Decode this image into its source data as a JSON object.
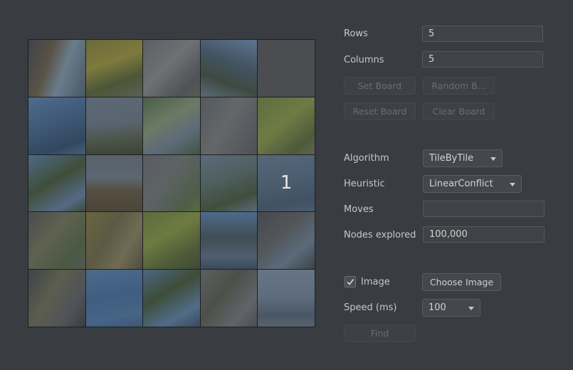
{
  "board": {
    "tiles": [
      {
        "label": "",
        "empty": false,
        "bg": "linear-gradient(110deg,#3d434a 0%,#5a5246 35%,#6a7c8c 60%,#4a5663 100%)"
      },
      {
        "label": "",
        "empty": false,
        "bg": "linear-gradient(160deg,#6b6a3a 0%,#7d7a3e 40%,#4d5638 70%,#5b5f54 100%)"
      },
      {
        "label": "",
        "empty": false,
        "bg": "linear-gradient(135deg,#5c5f62 0%,#6f7073 45%,#4e5356 80%,#5a5a52 100%)"
      },
      {
        "label": "",
        "empty": false,
        "bg": "linear-gradient(200deg,#5d7591 0%,#435462 40%,#3e4a40 70%,#5a6a78 100%)"
      },
      {
        "label": "",
        "empty": true,
        "bg": ""
      },
      {
        "label": "",
        "empty": false,
        "bg": "linear-gradient(160deg,#4e6c8e 0%,#3f5876 45%,#33485f 80%,#465e79 100%)"
      },
      {
        "label": "",
        "empty": false,
        "bg": "linear-gradient(175deg,#5b6877 0%,#5a6470 45%,#4a5346 75%,#3c4238 100%)"
      },
      {
        "label": "",
        "empty": false,
        "bg": "linear-gradient(150deg,#4a5f46 0%,#6b7a66 40%,#5c6a78 70%,#425340 100%)"
      },
      {
        "label": "",
        "empty": false,
        "bg": "linear-gradient(120deg,#55585c 0%,#64676a 45%,#4d5055 100%)"
      },
      {
        "label": "",
        "empty": false,
        "bg": "linear-gradient(140deg,#5c6e3e 0%,#6f7b45 45%,#4e5a3a 80%,#5d6550 100%)"
      },
      {
        "label": "",
        "empty": false,
        "bg": "linear-gradient(150deg,#4e6a85 0%,#3f4e3a 45%,#546a84 80%,#3c4a3a 100%)"
      },
      {
        "label": "",
        "empty": false,
        "bg": "linear-gradient(180deg,#58626b 0%,#5c6670 40%,#554d40 65%,#4b463b 100%)"
      },
      {
        "label": "",
        "empty": false,
        "bg": "linear-gradient(130deg,#595c60 0%,#5e6366 40%,#4f5d4a 80%,#5a6a3e 100%)"
      },
      {
        "label": "",
        "empty": false,
        "bg": "linear-gradient(160deg,#5b6a7a 0%,#4f6060 40%,#3f4e3c 75%,#5a6a7a 100%)"
      },
      {
        "label": "1",
        "empty": false,
        "bg": "linear-gradient(170deg,#56677a 0%,#4c5d70 45%,#425264 80%,#4a5a6c 100%)"
      },
      {
        "label": "",
        "empty": false,
        "bg": "linear-gradient(130deg,#4a4c4e 0%,#5f6150 40%,#4a5a44 75%,#545750 100%)"
      },
      {
        "label": "",
        "empty": false,
        "bg": "linear-gradient(120deg,#6a6440 0%,#5c5a44 40%,#6f6b54 70%,#4f4d3e 100%)"
      },
      {
        "label": "",
        "empty": false,
        "bg": "linear-gradient(150deg,#5d6a3d 0%,#6d7b42 40%,#4d5a38 75%,#3f4a36 100%)"
      },
      {
        "label": "",
        "empty": false,
        "bg": "linear-gradient(180deg,#4f6a8a 0%,#3f4e56 45%,#4e5e6e 80%,#3a4a5c 100%)"
      },
      {
        "label": "",
        "empty": false,
        "bg": "linear-gradient(140deg,#46494c 0%,#52565a 40%,#5b6a7a 70%,#3e4348 100%)"
      },
      {
        "label": "",
        "empty": false,
        "bg": "linear-gradient(120deg,#3e4346 0%,#5d5d4e 40%,#4f5258 75%,#383c40 100%)"
      },
      {
        "label": "",
        "empty": false,
        "bg": "linear-gradient(170deg,#4c6a8c 0%,#3f5e80 45%,#466485 80%,#3c5878 100%)"
      },
      {
        "label": "",
        "empty": false,
        "bg": "linear-gradient(150deg,#4b6784 0%,#3e4d38 40%,#506c88 75%,#3a4a5a 100%)"
      },
      {
        "label": "",
        "empty": false,
        "bg": "linear-gradient(130deg,#5c5f62 0%,#4d5048 40%,#60646a 75%,#4a4e52 100%)"
      },
      {
        "label": "",
        "empty": false,
        "bg": "linear-gradient(180deg,#667486 0%,#5d6b7c 50%,#4a5663 80%,#566270 100%)"
      }
    ]
  },
  "settings": {
    "rows_label": "Rows",
    "rows_value": "5",
    "columns_label": "Columns",
    "columns_value": "5",
    "set_board_label": "Set Board",
    "random_board_label": "Random B...",
    "reset_board_label": "Reset Board",
    "clear_board_label": "Clear Board",
    "algorithm_label": "Algorithm",
    "algorithm_value": "TileByTile",
    "heuristic_label": "Heuristic",
    "heuristic_value": "LinearConflict",
    "moves_label": "Moves",
    "moves_value": "",
    "nodes_label": "Nodes explored",
    "nodes_value": "100,000",
    "image_label": "Image",
    "image_checked": true,
    "choose_image_label": "Choose Image",
    "speed_label": "Speed (ms)",
    "speed_value": "100",
    "find_label": "Find"
  }
}
